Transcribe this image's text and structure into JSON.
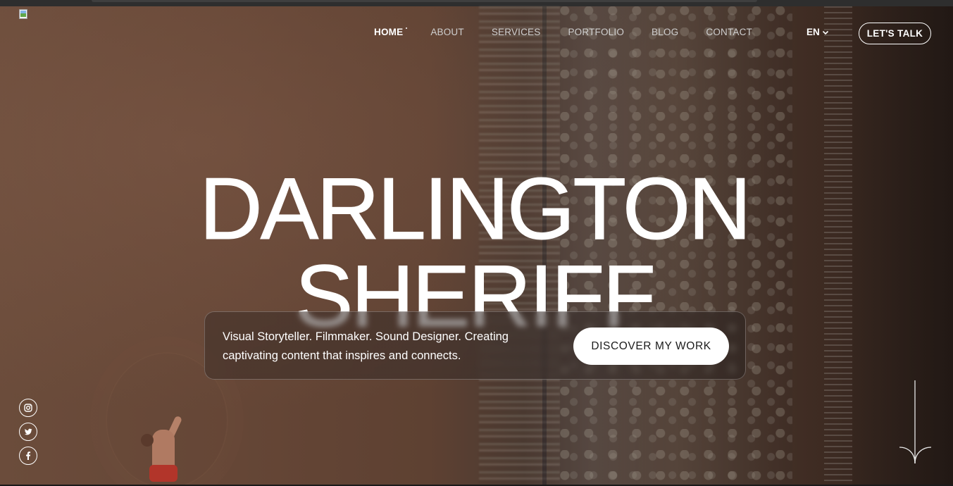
{
  "nav": {
    "items": [
      {
        "label": "HOME",
        "active": true
      },
      {
        "label": "ABOUT",
        "active": false
      },
      {
        "label": "SERVICES",
        "active": false
      },
      {
        "label": "PORTFOLIO",
        "active": false
      },
      {
        "label": "BLOG",
        "active": false
      },
      {
        "label": "CONTACT",
        "active": false
      }
    ],
    "language": "EN",
    "talk_button": "LET'S TALK"
  },
  "hero": {
    "title_line1": "DARLINGTON",
    "title_line2": "SHERIFF",
    "tagline": "Visual Storyteller. Filmmaker. Sound Designer. Creating captivating content that inspires and connects.",
    "cta_label": "DISCOVER MY WORK"
  },
  "social": {
    "icons": [
      "instagram-icon",
      "twitter-icon",
      "facebook-icon"
    ]
  },
  "colors": {
    "text": "#ffffff",
    "cta_bg": "#ffffff",
    "cta_text": "#1b1b1b"
  }
}
